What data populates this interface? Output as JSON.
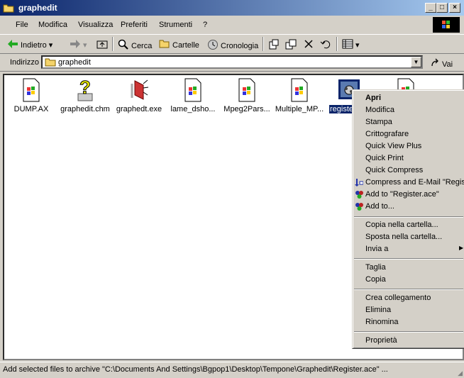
{
  "window": {
    "title": "graphedit",
    "controls": {
      "minimize": "_",
      "maximize": "□",
      "close": "×"
    }
  },
  "menu": [
    "File",
    "Modifica",
    "Visualizza",
    "Preferiti",
    "Strumenti",
    "?"
  ],
  "toolbar": {
    "back": "Indietro",
    "search": "Cerca",
    "folders": "Cartelle",
    "history": "Cronologia"
  },
  "address": {
    "label": "Indirizzo",
    "value": "graphedit",
    "go": "Vai"
  },
  "files": [
    {
      "name": "DUMP.AX",
      "icon": "system-file-icon"
    },
    {
      "name": "graphedit.chm",
      "icon": "help-file-icon"
    },
    {
      "name": "graphedt.exe",
      "icon": "graphedit-exe-icon"
    },
    {
      "name": "lame_dsho...",
      "icon": "system-file-icon"
    },
    {
      "name": "Mpeg2Pars...",
      "icon": "system-file-icon"
    },
    {
      "name": "Multiple_MP...",
      "icon": "system-file-icon"
    },
    {
      "name": "registe",
      "icon": "registry-file-icon",
      "selected": true
    },
    {
      "name": "",
      "icon": "system-file-icon"
    }
  ],
  "context_menu": {
    "groups": [
      [
        "Apri",
        "Modifica",
        "Stampa",
        "Crittografare",
        "Quick View Plus",
        "Quick Print",
        "Quick Compress",
        "Compress and E-Mail \"Registe",
        "Add to \"Register.ace\"",
        "Add to..."
      ],
      [
        "Copia nella cartella...",
        "Sposta nella cartella...",
        "Invia a"
      ],
      [
        "Taglia",
        "Copia"
      ],
      [
        "Crea collegamento",
        "Elimina",
        "Rinomina"
      ],
      [
        "Proprietà"
      ]
    ]
  },
  "status": {
    "text": "Add selected files to archive \"C:\\Documents And Settings\\Bgpop1\\Desktop\\Tempone\\Graphedit\\Register.ace\" ..."
  }
}
